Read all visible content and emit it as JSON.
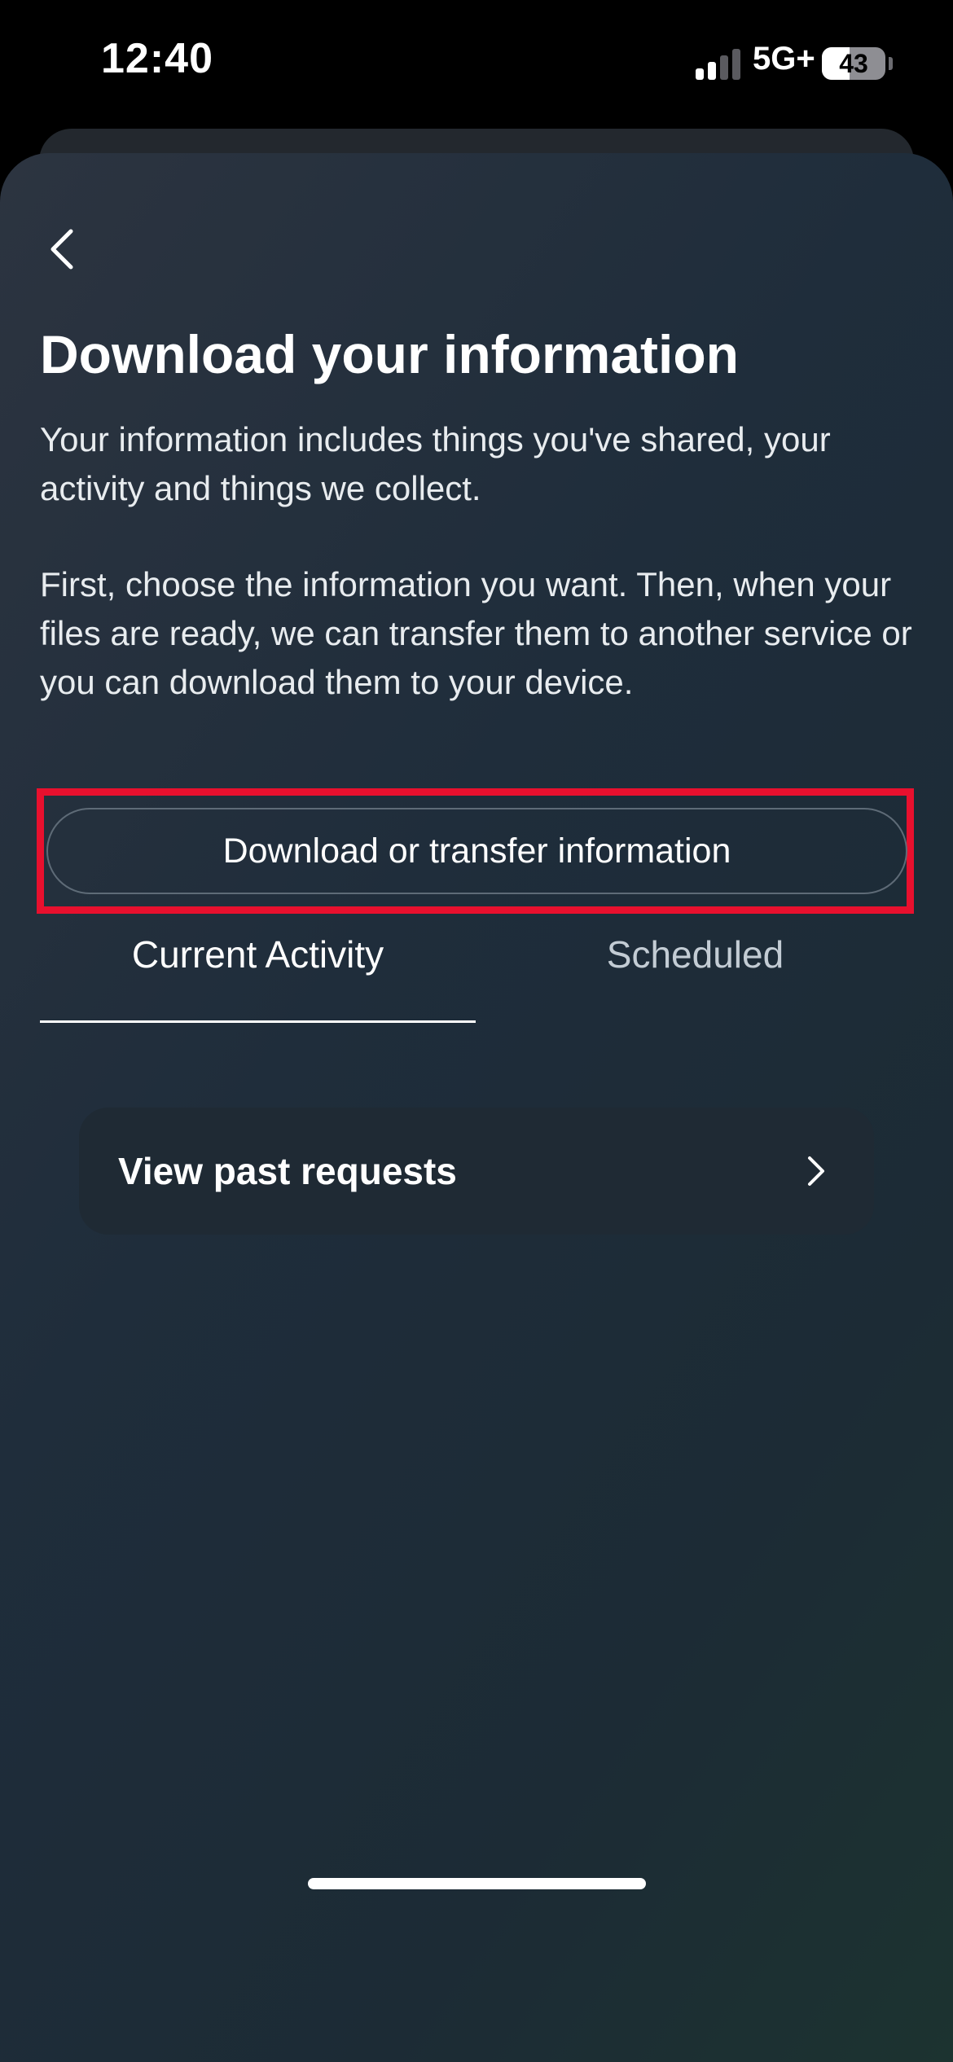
{
  "status_bar": {
    "time": "12:40",
    "network": "5G+",
    "battery_level": "43",
    "battery_fraction": 0.43,
    "signal_bars_active": 2,
    "signal_bars_total": 4
  },
  "header": {
    "back_icon": "chevron-left-icon"
  },
  "page": {
    "title": "Download your information",
    "intro": "Your information includes things you've shared, your activity and things we collect.",
    "detail": "First, choose the information you want. Then, when your files are ready, we can transfer them to another service or you can download them to your device."
  },
  "actions": {
    "primary_label": "Download or transfer information",
    "highlight_color": "#e8102e"
  },
  "tabs": [
    {
      "label": "Current Activity",
      "selected": true
    },
    {
      "label": "Scheduled",
      "selected": false
    }
  ],
  "list": {
    "items": [
      {
        "label": "View past requests",
        "icon": "chevron-right-icon"
      }
    ]
  },
  "colors": {
    "sheet_bg_start": "#2c3440",
    "sheet_bg_end": "#1c3330",
    "card_bg": "#1f2a34",
    "text_primary": "#ffffff",
    "text_secondary": "#c3ccd4"
  }
}
